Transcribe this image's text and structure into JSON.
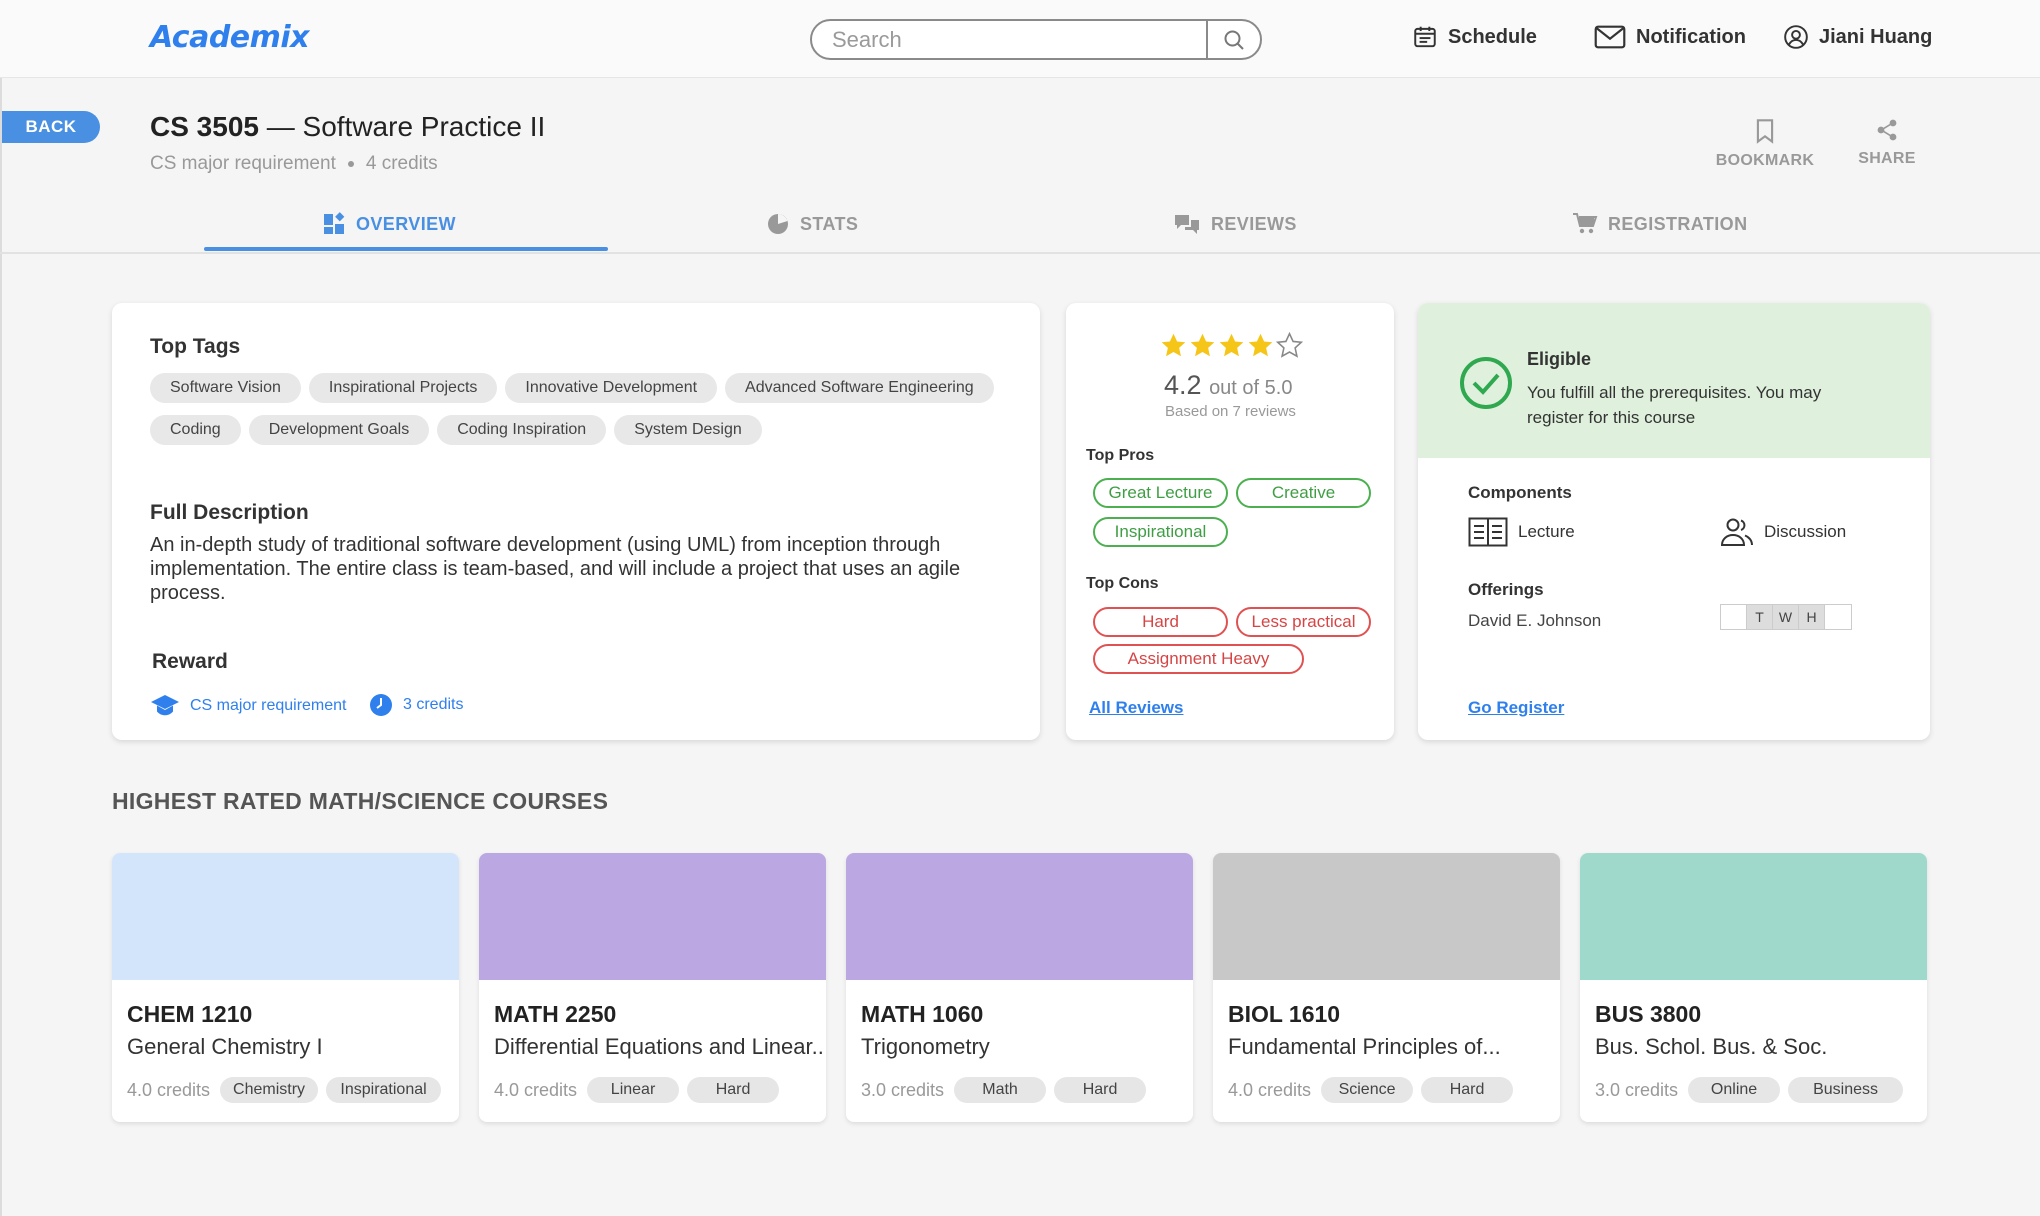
{
  "app": {
    "logo": "Academix"
  },
  "search": {
    "placeholder": "Search"
  },
  "nav": {
    "schedule": "Schedule",
    "notification": "Notification",
    "user": "Jiani Huang"
  },
  "course": {
    "back_label": "BACK",
    "code": "CS 3505",
    "dash": "—",
    "name": "Software Practice II",
    "requirement": "CS major requirement",
    "credits": "4 credits",
    "bookmark_label": "BOOKMARK",
    "share_label": "SHARE"
  },
  "tabs": [
    {
      "label": "OVERVIEW",
      "active": true
    },
    {
      "label": "STATS",
      "active": false
    },
    {
      "label": "REVIEWS",
      "active": false
    },
    {
      "label": "REGISTRATION",
      "active": false
    }
  ],
  "overview": {
    "top_tags_heading": "Top Tags",
    "top_tags": [
      "Software Vision",
      "Inspirational Projects",
      "Innovative Development",
      "Advanced Software Engineering",
      "Coding",
      "Development Goals",
      "Coding Inspiration",
      "System Design"
    ],
    "description_heading": "Full Description",
    "description": "An in-depth study of traditional software development (using UML) from inception through implementation. The entire class is team-based, and will include a project that uses an agile process.",
    "reward_heading": "Reward",
    "reward_requirement": "CS major requirement",
    "reward_credits": "3 credits"
  },
  "rating": {
    "stars_filled": 4,
    "stars_total": 5,
    "score": "4.2",
    "out_of": "out of 5.0",
    "based_on": "Based on 7 reviews",
    "pros_heading": "Top Pros",
    "pros": [
      "Great Lecture",
      "Creative",
      "Inspirational"
    ],
    "cons_heading": "Top Cons",
    "cons": [
      "Hard",
      "Less practical",
      "Assignment Heavy"
    ],
    "all_reviews_label": "All Reviews"
  },
  "eligibility": {
    "status": "Eligible",
    "message": "You fulfill all the prerequisites. You may register for this course",
    "components_heading": "Components",
    "components": [
      "Lecture",
      "Discussion"
    ],
    "offerings_heading": "Offerings",
    "instructor": "David E. Johnson",
    "days": [
      "",
      "T",
      "W",
      "H",
      ""
    ],
    "go_register_label": "Go Register",
    "status_color": "#4caf50"
  },
  "highest_rated": {
    "heading": "HIGHEST RATED MATH/SCIENCE COURSES",
    "courses": [
      {
        "code": "CHEM 1210",
        "name": "General Chemistry I",
        "credits": "4.0 credits",
        "tags": [
          "Chemistry",
          "Inspirational"
        ],
        "color": "#d3e5fb"
      },
      {
        "code": "MATH 2250",
        "name": "Differential Equations and Linear..",
        "credits": "4.0 credits",
        "tags": [
          "Linear",
          "Hard"
        ],
        "color": "#bba8e3"
      },
      {
        "code": "MATH 1060",
        "name": "Trigonometry",
        "credits": "3.0 credits",
        "tags": [
          "Math",
          "Hard"
        ],
        "color": "#bba8e3"
      },
      {
        "code": "BIOL 1610",
        "name": "Fundamental Principles of...",
        "credits": "4.0 credits",
        "tags": [
          "Science",
          "Hard"
        ],
        "color": "#c8c8c8"
      },
      {
        "code": "BUS 3800",
        "name": "Bus. Schol. Bus. & Soc.",
        "credits": "3.0 credits",
        "tags": [
          "Online",
          "Business"
        ],
        "color": "#9fd9cc"
      }
    ]
  }
}
